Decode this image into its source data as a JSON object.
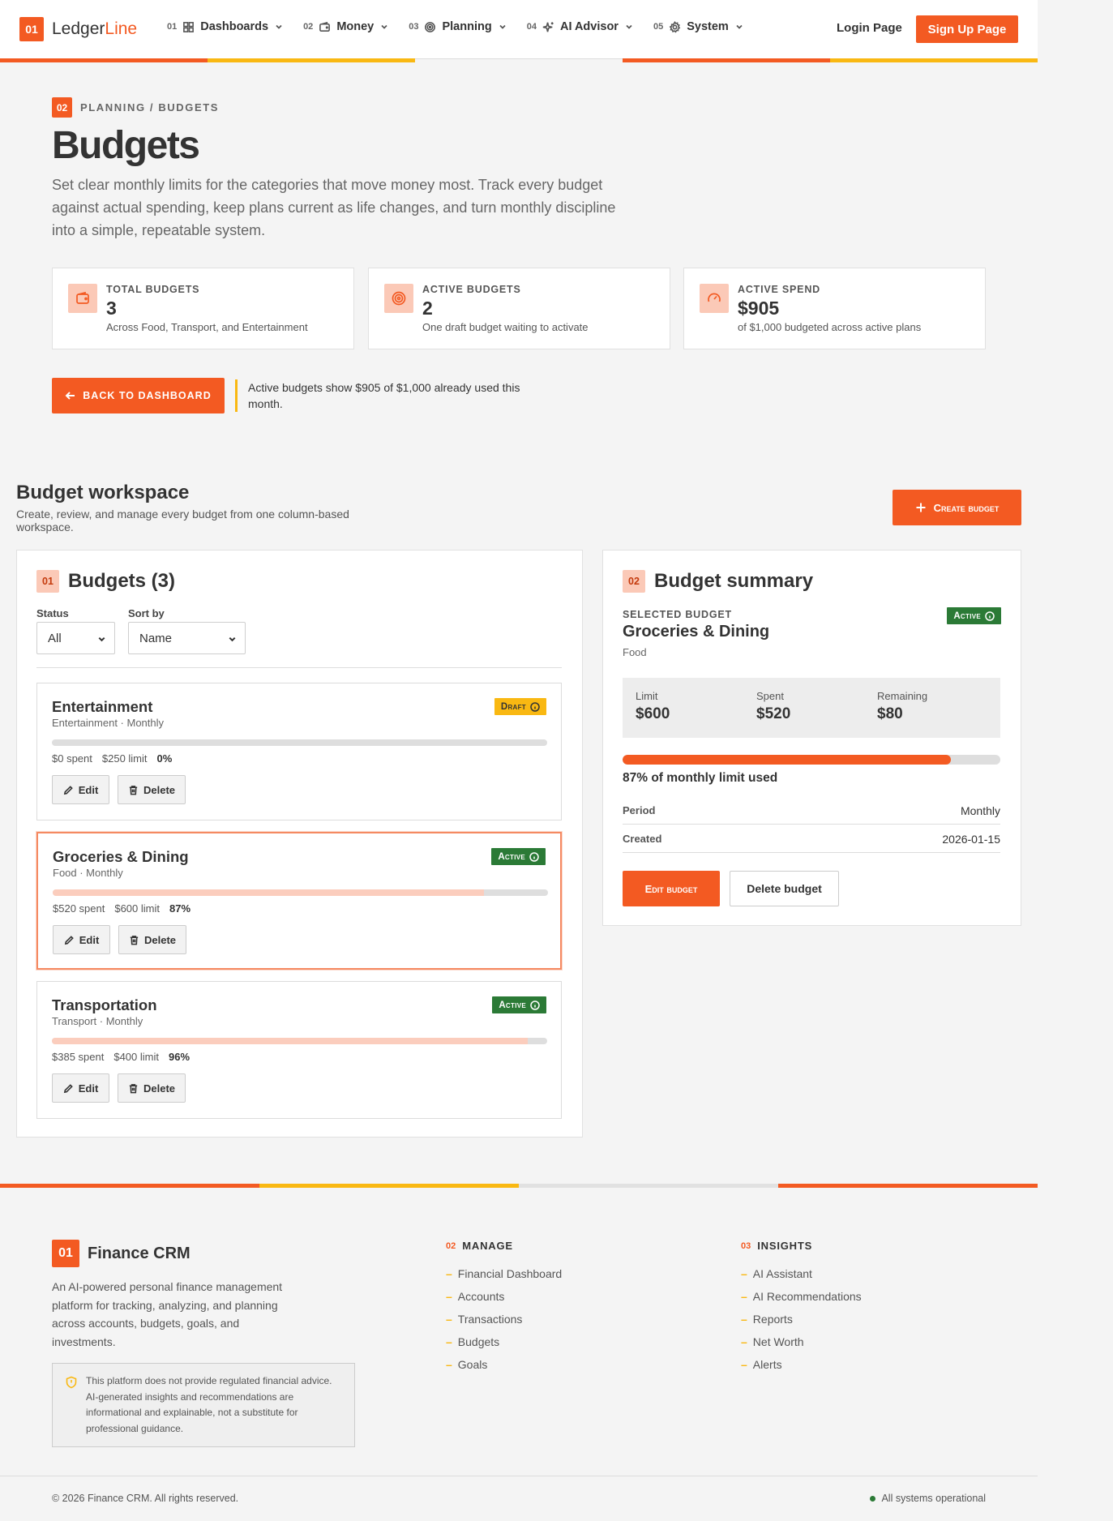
{
  "header": {
    "brand_number": "01",
    "brand_first": "Ledger",
    "brand_second": "Line",
    "nav": [
      {
        "num": "01",
        "label": "Dashboards",
        "icon": "grid-icon"
      },
      {
        "num": "02",
        "label": "Money",
        "icon": "wallet-icon"
      },
      {
        "num": "03",
        "label": "Planning",
        "icon": "target-icon"
      },
      {
        "num": "04",
        "label": "AI Advisor",
        "icon": "sparkles-icon"
      },
      {
        "num": "05",
        "label": "System",
        "icon": "gear-icon"
      }
    ],
    "login": "Login Page",
    "signup": "Sign Up Page"
  },
  "colors": {
    "accent": "#f35a22",
    "yellow": "#f9b812",
    "active_green": "#2b7a36",
    "soft_accent": "#fbc9b7"
  },
  "hero": {
    "crumb_number": "02",
    "crumb": "PLANNING / BUDGETS",
    "title": "Budgets",
    "lead": "Set clear monthly limits for the categories that move money most. Track every budget against actual spending, keep plans current as life changes, and turn monthly discipline into a simple, repeatable system.",
    "stats": [
      {
        "label": "TOTAL BUDGETS",
        "value": "3",
        "sub": "Across Food, Transport, and Entertainment",
        "icon": "wallet-icon"
      },
      {
        "label": "ACTIVE BUDGETS",
        "value": "2",
        "sub": "One draft budget waiting to activate",
        "icon": "target-icon"
      },
      {
        "label": "ACTIVE SPEND",
        "value": "$905",
        "sub": "of $1,000 budgeted across active plans",
        "icon": "gauge-icon"
      }
    ],
    "back_button": "BACK TO DASHBOARD",
    "note": "Active budgets show $905 of $1,000 already used this month."
  },
  "workspace": {
    "title": "Budget workspace",
    "subtitle": "Create, review, and manage every budget from one column-based workspace.",
    "create_button": "Create budget",
    "list": {
      "number": "01",
      "title": "Budgets (3)",
      "status_label": "Status",
      "status_value": "All",
      "sort_label": "Sort by",
      "sort_value": "Name",
      "items": [
        {
          "name": "Entertainment",
          "meta": "Entertainment · Monthly",
          "spent": "$0 spent",
          "limit": "$250 limit",
          "pct": "0%",
          "fill": 0,
          "status": "Draft",
          "edit": "Edit",
          "delete": "Delete"
        },
        {
          "name": "Groceries & Dining",
          "meta": "Food · Monthly",
          "spent": "$520 spent",
          "limit": "$600 limit",
          "pct": "87%",
          "fill": 87,
          "status": "Active",
          "edit": "Edit",
          "delete": "Delete"
        },
        {
          "name": "Transportation",
          "meta": "Transport · Monthly",
          "spent": "$385 spent",
          "limit": "$400 limit",
          "pct": "96%",
          "fill": 96,
          "status": "Active",
          "edit": "Edit",
          "delete": "Delete"
        }
      ]
    },
    "summary": {
      "number": "02",
      "title": "Budget summary",
      "selected_label": "SELECTED BUDGET",
      "status": "Active",
      "name": "Groceries & Dining",
      "category": "Food",
      "limit_label": "Limit",
      "limit": "$600",
      "spent_label": "Spent",
      "spent": "$520",
      "remaining_label": "Remaining",
      "remaining": "$80",
      "fill": 87,
      "pct_text": "87% of monthly limit used",
      "period_label": "Period",
      "period": "Monthly",
      "created_label": "Created",
      "created": "2026-01-15",
      "edit_button": "Edit budget",
      "delete_button": "Delete budget"
    }
  },
  "footer": {
    "brand_number": "01",
    "brand": "Finance CRM",
    "desc": "An AI-powered personal finance management platform for tracking, analyzing, and planning across accounts, budgets, goals, and investments.",
    "disclaimer": "This platform does not provide regulated financial advice. AI-generated insights and recommendations are informational and explainable, not a substitute for professional guidance.",
    "manage": {
      "number": "02",
      "title": "MANAGE",
      "links": [
        "Financial Dashboard",
        "Accounts",
        "Transactions",
        "Budgets",
        "Goals"
      ]
    },
    "insights": {
      "number": "03",
      "title": "INSIGHTS",
      "links": [
        "AI Assistant",
        "AI Recommendations",
        "Reports",
        "Net Worth",
        "Alerts"
      ]
    },
    "copyright": "© 2026 Finance CRM. All rights reserved.",
    "status": "All systems operational"
  }
}
